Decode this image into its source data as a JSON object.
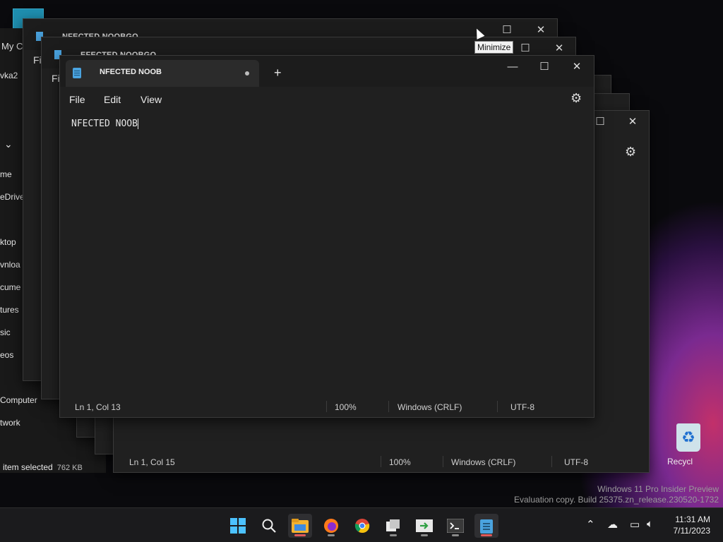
{
  "explorer": {
    "my_computer_label": "My C",
    "user_label": "vka2",
    "items": [
      "me",
      "eDrive",
      "ktop",
      "vnloa",
      "cume",
      "tures",
      "sic",
      "eos",
      "Computer",
      "twork"
    ],
    "status_selected": "item selected",
    "status_size": "762 KB"
  },
  "ghost_windows": {
    "title1": "NFECTED NOOBGO",
    "title2": "EFECTED NOOBGO",
    "menu_file": "Fi",
    "back_status_ln": "Ln 1, Col 15",
    "back_status_zoom": "100%",
    "back_status_eol": "Windows (CRLF)",
    "back_status_enc": "UTF-8"
  },
  "notepad": {
    "tab_title": "NFECTED NOOB",
    "menu": {
      "file": "File",
      "edit": "Edit",
      "view": "View"
    },
    "content": "NFECTED NOOB",
    "status": {
      "position": "Ln 1, Col 13",
      "zoom": "100%",
      "line_ending": "Windows (CRLF)",
      "encoding": "UTF-8"
    }
  },
  "tooltip": "Minimize",
  "watermark": {
    "line1": "Windows 11 Pro Insider Preview",
    "line2": "Evaluation copy. Build 25375.zn_release.230520-1732"
  },
  "desktop": {
    "recycle_label": "Recycl"
  },
  "taskbar": {
    "apps": [
      "windows-start-icon",
      "search-icon",
      "file-explorer-icon",
      "firefox-icon",
      "chrome-icon",
      "files-icon",
      "arrow-app-icon",
      "terminal-icon",
      "notepad-icon"
    ]
  },
  "clock": {
    "time": "11:31 AM",
    "date": "7/11/2023"
  },
  "colors": {
    "accent": "#4aa3df",
    "indicator": "#e05a5a"
  }
}
